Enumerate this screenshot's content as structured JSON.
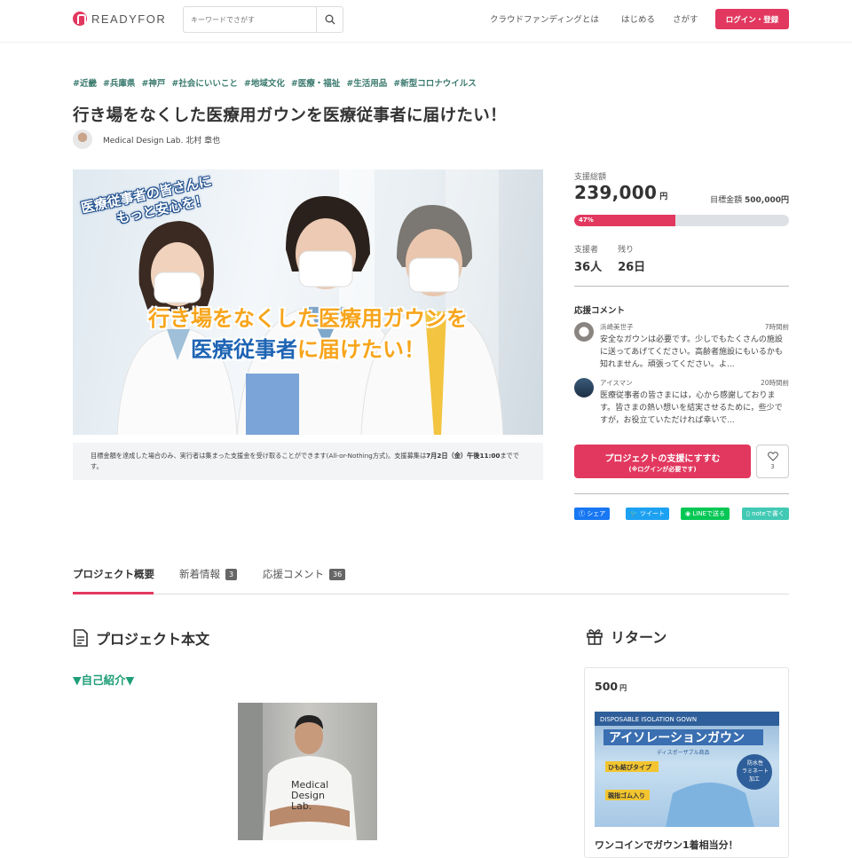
{
  "header": {
    "logo_text": "READYFOR",
    "search_placeholder": "キーワードでさがす",
    "nav": [
      "クラウドファンディングとは",
      "はじめる",
      "さがす"
    ],
    "login": "ログイン・登録"
  },
  "project": {
    "tags": [
      "#近畿",
      "#兵庫県",
      "#神戸",
      "#社会にいいこと",
      "#地域文化",
      "#医療・福祉",
      "#生活用品",
      "#新型コロナウイルス"
    ],
    "title": "行き場をなくした医療用ガウンを医療従事者に届けたい！",
    "owner": "Medical Design Lab. 北村 章也",
    "hero_badge_line1": "医療従事者の皆さんに",
    "hero_badge_line2": "もっと安心を！",
    "hero_line1": "行き場をなくした医療用ガウンを",
    "hero_line2a": "医療従事者",
    "hero_line2b": "に届けたい！",
    "notice_pre": "目標金額を達成した場合のみ、実行者は集まった支援金を受け取ることができます(All-or-Nothing方式)。支援募集は",
    "notice_date": "7月2日（金）午後11:00",
    "notice_post": "までです。"
  },
  "funding": {
    "total_label": "支援総額",
    "total": "239,000",
    "yen": "円",
    "goal_label": "目標金額",
    "goal": "500,000円",
    "percent_label": "47%",
    "percent": 0.47,
    "supporters_label": "支援者",
    "supporters": "36人",
    "remaining_label": "残り",
    "remaining": "26日"
  },
  "comments": {
    "title": "応援コメント",
    "items": [
      {
        "name": "浜崎美世子",
        "time": "7時間前",
        "text": "安全なガウンは必要です。少しでもたくさんの施設に送ってあげてください。高齢者施設にもいるかも知れません。頑張ってください。よ..."
      },
      {
        "name": "アイスマン",
        "time": "20時間前",
        "text": "医療従事者の皆さまには，心から感謝しております。皆さまの熱い想いを結実させるために，些少ですが，お役立ていただければ幸いで..."
      }
    ]
  },
  "actions": {
    "support_line1": "プロジェクトの支援にすすむ",
    "support_line2": "(※ログインが必要です)",
    "like_count": "3",
    "share": [
      "シェア",
      "ツイート",
      "LINEで送る",
      "noteで書く"
    ]
  },
  "tabs": [
    {
      "label": "プロジェクト概要",
      "count": ""
    },
    {
      "label": "新着情報",
      "count": "3"
    },
    {
      "label": "応援コメント",
      "count": "36"
    }
  ],
  "body": {
    "section_title": "プロジェクト本文",
    "intro_heading": "▼自己紹介▼",
    "photo_shirt_text": [
      "Medical",
      "Design",
      "Lab."
    ]
  },
  "returns": {
    "title": "リターン",
    "price": "500",
    "yen": "円",
    "image_text": [
      "DISPOSABLE ISOLATION GOWN",
      "アイソレーションガウン",
      "ディスポーザブル商品",
      "ひも結びタイプ",
      "親指ゴム入り",
      "防水性",
      "ラミネート",
      "加工"
    ],
    "reward_title": "ワンコインでガウン1着相当分！"
  },
  "colors": {
    "accent": "#e2385f",
    "tag": "#3a7a6e",
    "intro": "#1f9e77",
    "facebook": "#1877f2",
    "twitter": "#1da1f2",
    "line": "#06c755",
    "note": "#41c9b4"
  }
}
